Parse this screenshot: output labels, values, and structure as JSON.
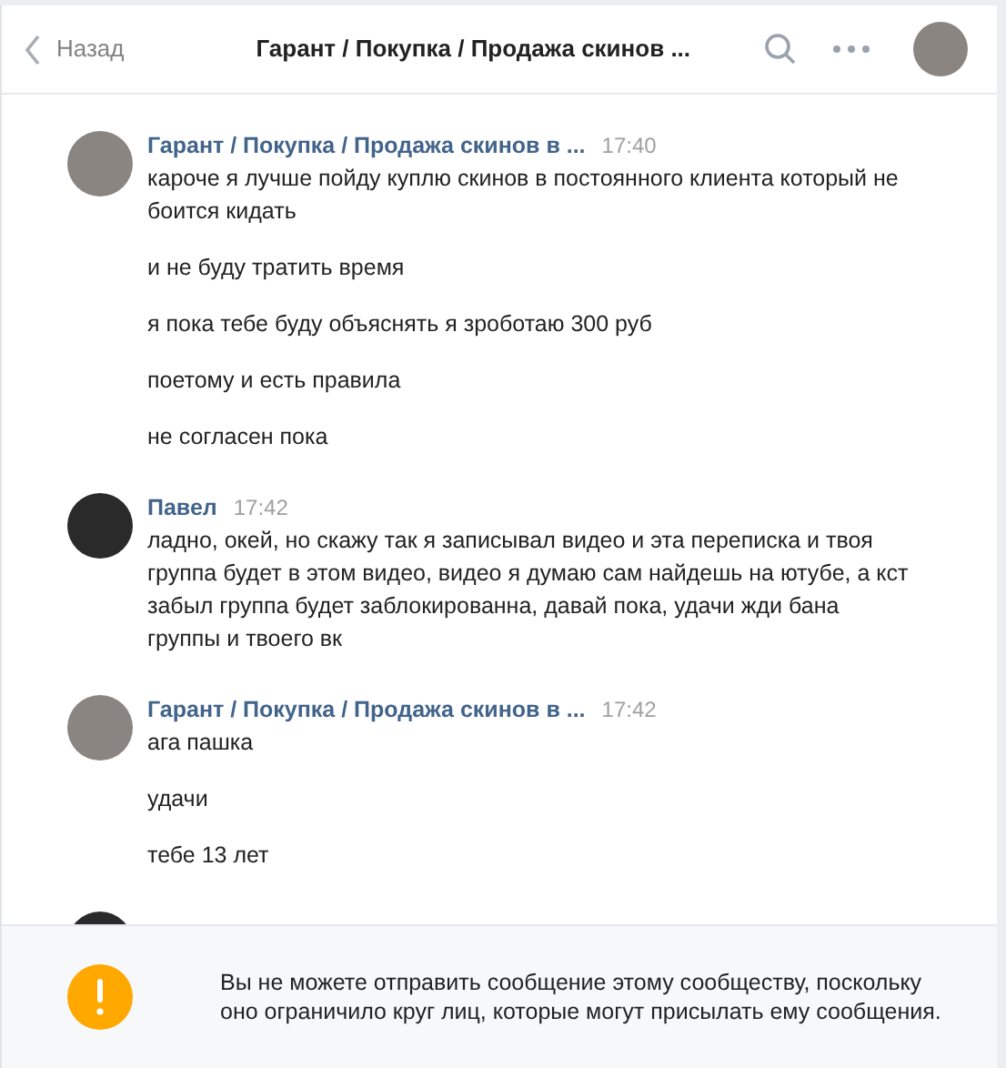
{
  "header": {
    "back": "Назад",
    "title": "Гарант / Покупка / Продажа скинов ..."
  },
  "messages": [
    {
      "author": "Гарант / Покупка / Продажа скинов в ...",
      "time": "17:40",
      "texts": [
        "кароче я лучше пойду куплю скинов в постоянного клиента который не боится кидать",
        "и не буду тратить время",
        "я пока тебе буду объяснять я зроботаю 300 руб",
        "поетому и есть правила",
        "не согласен пока"
      ]
    },
    {
      "author": "Павел",
      "time": "17:42",
      "texts": [
        "ладно, окей, но скажу так я записывал видео и эта переписка и твоя группа будет в этом видео, видео я думаю сам найдешь на ютубе, а кст забыл группа будет заблокированна, давай пока, удачи жди бана группы и твоего вк"
      ]
    },
    {
      "author": "Гарант / Покупка / Продажа скинов в ...",
      "time": "17:42",
      "texts": [
        "ага пашка",
        "удачи",
        "тебе 13 лет"
      ]
    }
  ],
  "notice": {
    "text": "Вы не можете отправить сообщение этому сообществу, поскольку оно ограничило круг лиц, которые могут присылать ему сообщения."
  }
}
